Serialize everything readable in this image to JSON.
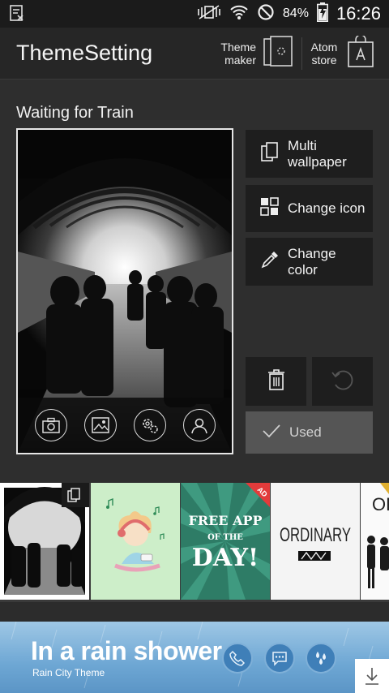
{
  "status_bar": {
    "battery": "84%",
    "time": "16:26",
    "icons": [
      "sim-icon",
      "mute-vibrate-icon",
      "wifi-icon",
      "blocked-icon",
      "battery-charging-icon"
    ]
  },
  "app_bar": {
    "title": "ThemeSetting",
    "theme_maker": "Theme\nmaker",
    "atom_store": "Atom\nstore"
  },
  "theme": {
    "name": "Waiting for Train"
  },
  "actions": {
    "multi_wallpaper": "Multi\nwallpaper",
    "change_icon": "Change icon",
    "change_color": "Change\ncolor",
    "used": "Used"
  },
  "thumbnails": [
    {
      "icons": [
        "copy-icon"
      ]
    },
    {
      "icons": []
    },
    {
      "badge": "AD",
      "line1": "FREE APP",
      "line2": "OF THE",
      "line3": "DAY!"
    },
    {
      "text": "ORDINARY"
    },
    {
      "text": "OR"
    }
  ],
  "banner": {
    "title": "In a rain shower",
    "subtitle": "Rain City Theme",
    "icons": [
      "phone-icon",
      "message-icon",
      "drops-icon",
      "download-icon"
    ]
  },
  "colors": {
    "background": "#2b2b2b",
    "panel": "#1e1e1e",
    "used_button": "#555555",
    "banner": "#6ea7d4"
  }
}
